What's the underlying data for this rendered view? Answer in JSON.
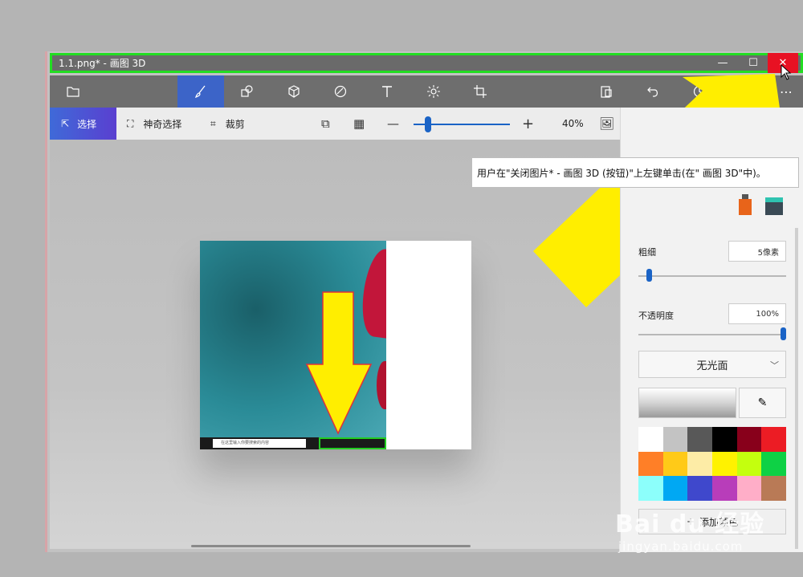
{
  "window": {
    "title": "1.1.png* - 画图 3D",
    "minimize_glyph": "—",
    "maximize_glyph": "☐",
    "close_glyph": "✕"
  },
  "toolbar": {
    "tools": [
      {
        "name": "menu",
        "icon": "folder-icon"
      },
      {
        "name": "brushes",
        "icon": "brush-icon",
        "active": true
      },
      {
        "name": "2d-shapes",
        "icon": "shapes-icon"
      },
      {
        "name": "3d-shapes",
        "icon": "cube-icon"
      },
      {
        "name": "stickers",
        "icon": "sticker-icon"
      },
      {
        "name": "text",
        "icon": "text-icon"
      },
      {
        "name": "effects",
        "icon": "sun-icon"
      },
      {
        "name": "canvas",
        "icon": "crop-canvas-icon"
      },
      {
        "name": "paste",
        "icon": "paste-icon"
      },
      {
        "name": "undo",
        "icon": "undo-icon"
      },
      {
        "name": "history",
        "icon": "history-icon"
      },
      {
        "name": "more",
        "icon": "more-icon"
      }
    ],
    "more_glyph": "⋯"
  },
  "subbar": {
    "select_label": "选择",
    "magic_select_label": "神奇选择",
    "crop_label": "裁剪",
    "zoom_value": "40%",
    "zoom_fraction": 0.15,
    "minus_glyph": "—",
    "plus_glyph": "+"
  },
  "tooltip": {
    "text": "用户在\"关闭图片* - 画图 3D (按钮)\"上左键单击(在\" 画图 3D\"中)。"
  },
  "panel": {
    "thickness_label": "粗细",
    "thickness_value": "5像素",
    "thickness_fraction": 0.05,
    "opacity_label": "不透明度",
    "opacity_value": "100%",
    "opacity_fraction": 1.0,
    "finish_label": "无光面",
    "add_color_label": "添加颜色",
    "swatches": [
      "#ffffff",
      "#c3c3c3",
      "#585858",
      "#000000",
      "#88001b",
      "#ec1c24",
      "#ff7f27",
      "#ffca18",
      "#fdeca6",
      "#fff200",
      "#c4ff0e",
      "#0ed145",
      "#8cfffb",
      "#00a8f3",
      "#3f48cc",
      "#b83dba",
      "#ffaec8",
      "#b97a56"
    ]
  },
  "image": {
    "taskbar_search": "在这里输入你要搜索的内容"
  },
  "watermark": {
    "brand": "Bai du 经验",
    "url": "jingyan.baidu.com"
  },
  "colors": {
    "accent": "#3c64c8",
    "close_red": "#e81123",
    "highlight_green": "#22dd22",
    "arrow_yellow": "#ffee00"
  }
}
